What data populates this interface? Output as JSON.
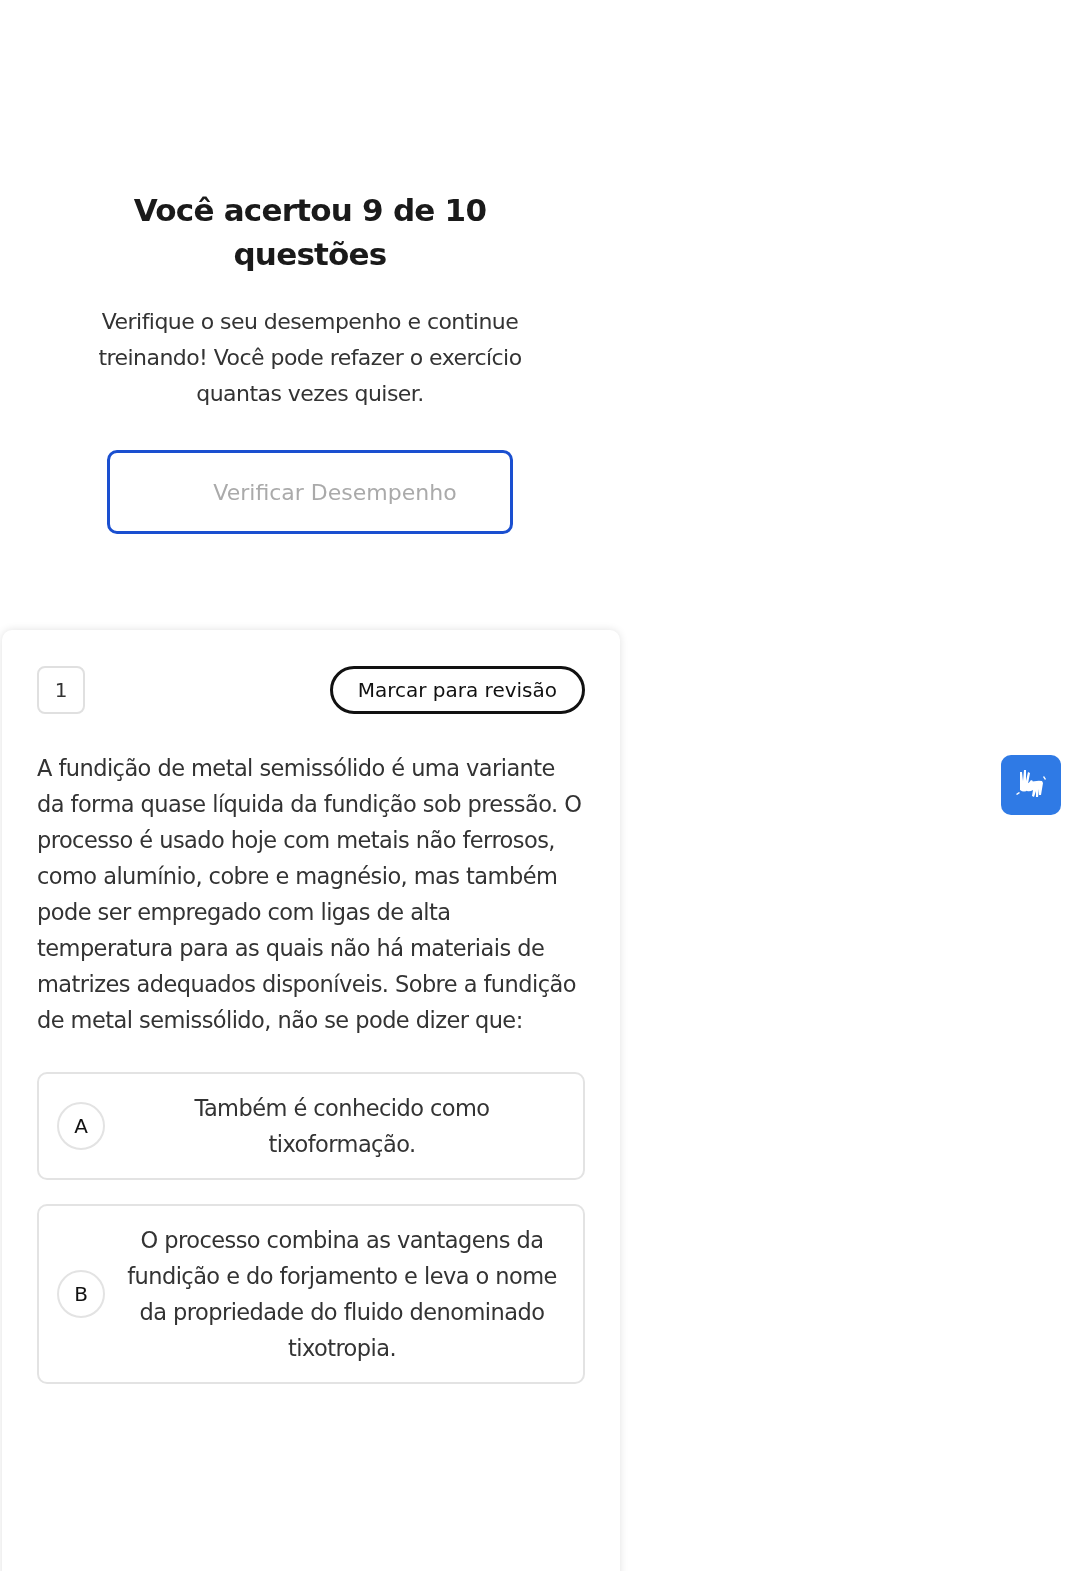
{
  "result": {
    "title": "Você acertou 9 de 10 questões",
    "description": "Verifique o seu desempenho e continue treinando! Você pode refazer o exercício quantas vezes quiser.",
    "button": "Verificar Desempenho"
  },
  "question": {
    "number": "1",
    "review_button": "Marcar para revisão",
    "text": "A fundição de metal semissólido é uma variante da forma quase líquida da fundição sob pressão. O processo é usado hoje com metais não ferrosos, como alumínio, cobre e magnésio, mas também pode ser empregado com ligas de alta temperatura para as quais não há materiais de matrizes adequados disponíveis. Sobre a fundição de metal semissólido, não se pode dizer que:",
    "options": [
      {
        "letter": "A",
        "text": "Também é conhecido como tixoformação."
      },
      {
        "letter": "B",
        "text": "O processo combina as vantagens da fundição e do forjamento e leva o nome da propriedade do fluido denominado tixotropia."
      }
    ]
  }
}
